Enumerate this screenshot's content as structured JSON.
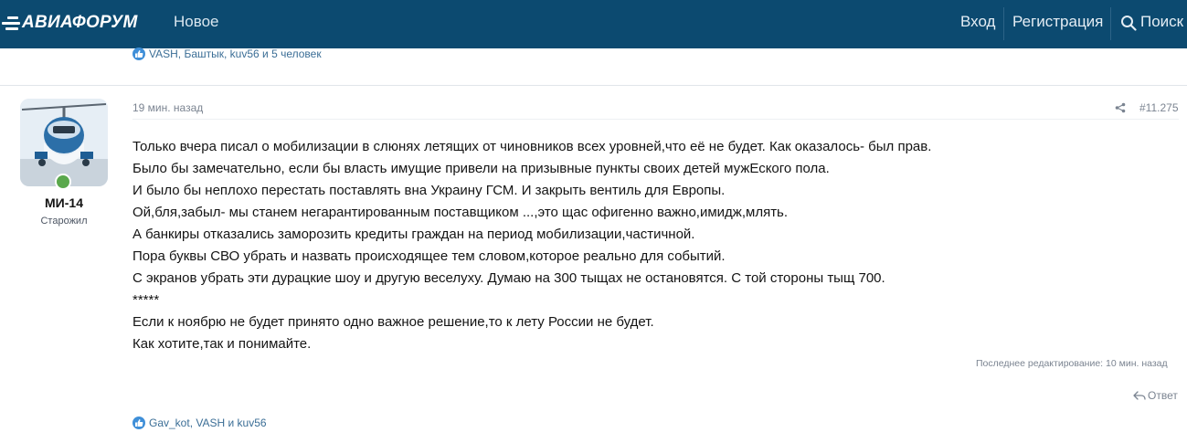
{
  "header": {
    "logo_text": "АВИАФОРУМ",
    "nav_new": "Новое",
    "login": "Вход",
    "register": "Регистрация",
    "search": "Поиск"
  },
  "prev_post": {
    "reactions": "VASH, Баштык, kuv56 и 5 человек"
  },
  "post": {
    "time": "19 мин. назад",
    "number": "#11.275",
    "author": {
      "name": "МИ-14",
      "title": "Старожил"
    },
    "body": [
      "Только вчера писал о мобилизации в слюнях летящих от чиновников всех уровней,что её не будет. Как оказалось- был прав.",
      "Было бы замечательно, если бы власть имущие привели на призывные пункты своих детей мужЕского пола.",
      "И было бы неплохо перестать поставлять вна Украину ГСМ. И закрыть вентиль для Европы.",
      "Ой,бля,забыл- мы станем негарантированным поставщиком ...,это щас офигенно важно,имидж,млять.",
      "А банкиры отказались заморозить кредиты граждан на период мобилизации,частичной.",
      "Пора буквы СВО убрать и назвать происходящее тем словом,которое реально для событий.",
      "С экранов убрать эти дурацкие шоу и другую веселуху. Думаю на 300 тыщах не остановятся. С той стороны тыщ 700.",
      "*****",
      "Если к ноябрю не будет принято одно важное решение,то к лету России не будет.",
      "Как хотите,так и понимайте."
    ],
    "last_edit": "Последнее редактирование: 10 мин. назад",
    "reply": "Ответ",
    "reactions": "Gav_kot, VASH и kuv56"
  },
  "colors": {
    "header_bg": "#0c4a70",
    "link": "#3b6e96",
    "reaction_icon": "#3f8fd8",
    "online": "#5aa84c"
  },
  "icons": [
    "logo-mark-icon",
    "search-icon",
    "like-icon",
    "share-icon",
    "reply-icon",
    "online-status-icon"
  ]
}
